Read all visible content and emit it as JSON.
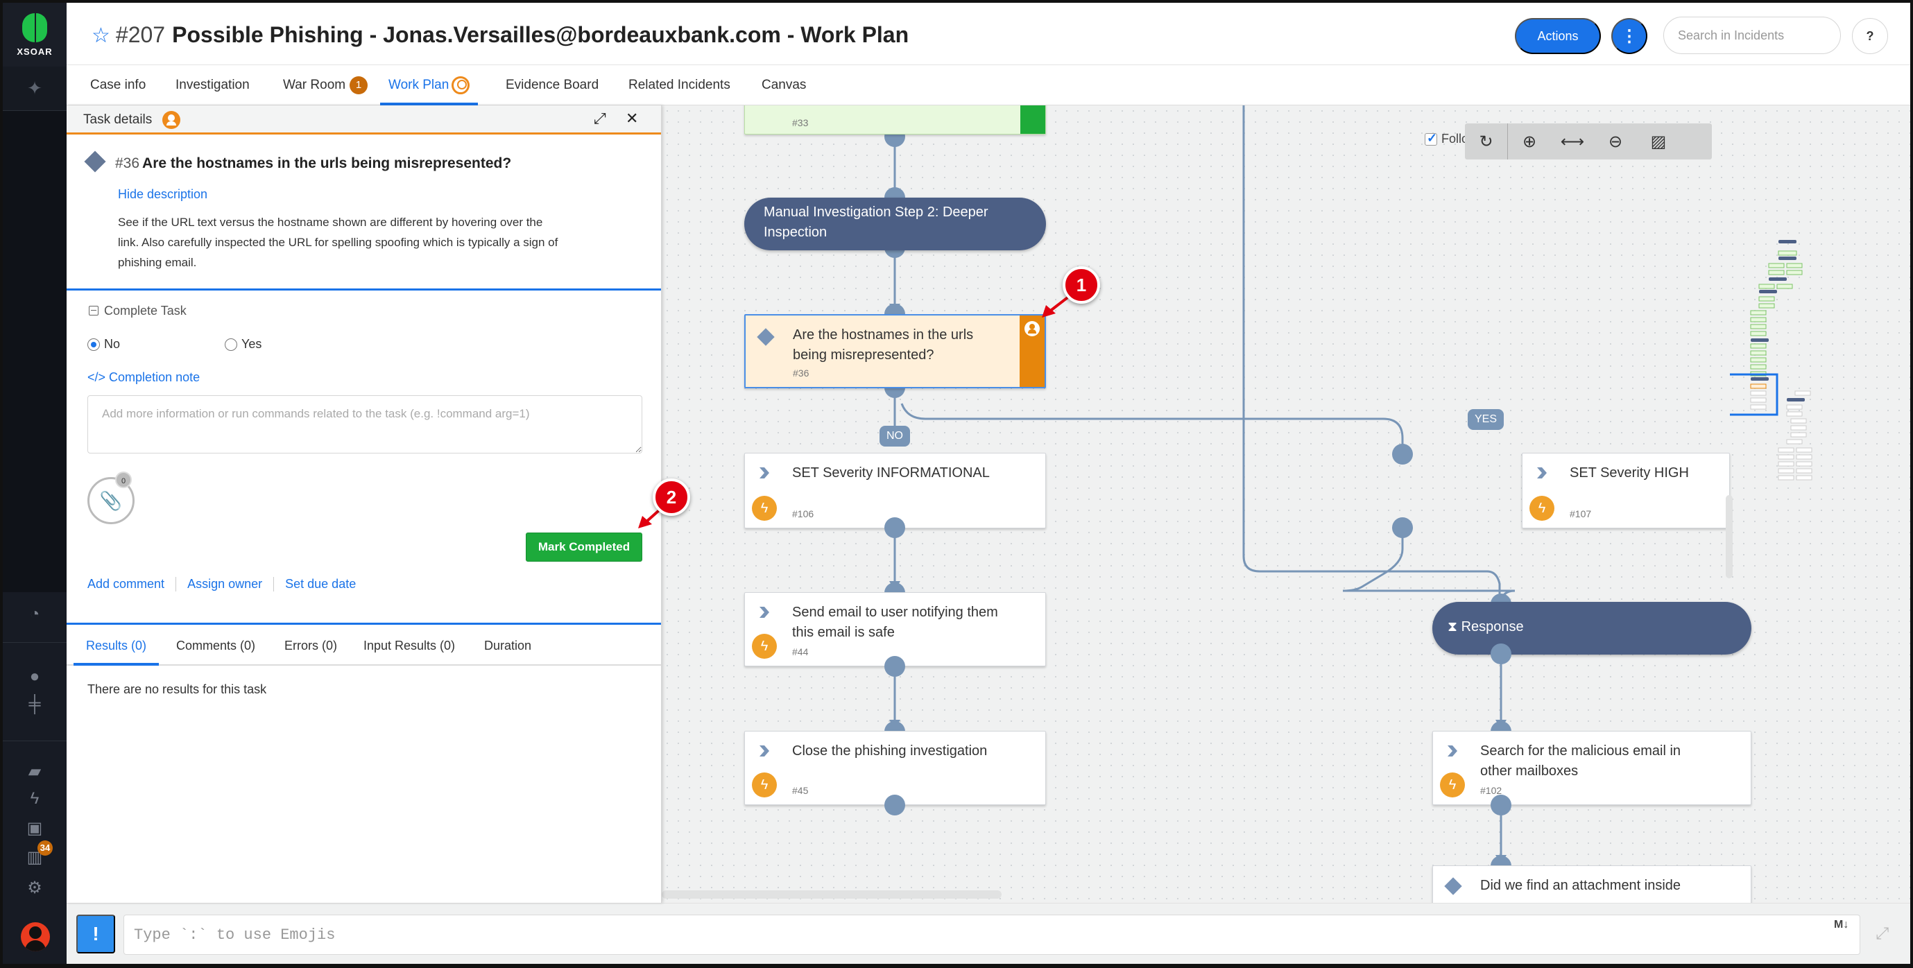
{
  "app": {
    "logo_text": "XSOAR"
  },
  "sidebar": {
    "notification_count": "34",
    "items": [
      {
        "icon": "pin-icon"
      },
      {
        "icon": "dashboard-gauge-icon"
      },
      {
        "icon": "bomb-icon"
      },
      {
        "icon": "signpost-icon"
      },
      {
        "icon": "book-icon"
      },
      {
        "icon": "lightning-icon"
      },
      {
        "icon": "briefcase-icon"
      },
      {
        "icon": "database-icon"
      },
      {
        "icon": "gear-icon"
      },
      {
        "icon": "user-avatar-icon"
      }
    ]
  },
  "header": {
    "incident_number": "#207",
    "incident_name": "Possible Phishing - Jonas.Versailles@bordeauxbank.com - Work Plan",
    "actions_label": "Actions",
    "more_label": "⋮",
    "search_placeholder": "Search in Incidents",
    "help_label": "?"
  },
  "tabs": [
    {
      "label": "Case info"
    },
    {
      "label": "Investigation"
    },
    {
      "label": "War Room",
      "count": "1"
    },
    {
      "label": "Work Plan",
      "active": true
    },
    {
      "label": "Evidence Board"
    },
    {
      "label": "Related Incidents"
    },
    {
      "label": "Canvas"
    }
  ],
  "task_panel": {
    "title": "Task details",
    "task_id": "#36",
    "task_name": "Are the hostnames in the urls being misrepresented?",
    "hide_description": "Hide description",
    "description": "See if the URL text versus the hostname shown are different by hovering over the link. Also carefully inspected the URL for spelling spoofing which is typically a sign of phishing email.",
    "complete_task": "Complete Task",
    "options": [
      {
        "label": "No",
        "selected": true
      },
      {
        "label": "Yes",
        "selected": false
      }
    ],
    "completion_note_label": "Completion note",
    "completion_note_placeholder": "Add more information or run commands related to the task (e.g. !command arg=1)",
    "completion_note_value": "",
    "attachment_count": "0",
    "mark_completed": "Mark Completed",
    "links": [
      "Add comment",
      "Assign owner",
      "Set due date"
    ],
    "result_tabs": [
      {
        "label": "Results (0)",
        "active": true
      },
      {
        "label": "Comments (0)"
      },
      {
        "label": "Errors (0)"
      },
      {
        "label": "Input Results (0)"
      },
      {
        "label": "Duration"
      }
    ],
    "no_results": "There are no results for this task"
  },
  "canvas": {
    "follow_label": "Follow",
    "follow_checked": true,
    "tools": [
      "refresh-icon",
      "zoom-in-icon",
      "fit-width-icon",
      "zoom-out-icon",
      "export-image-icon"
    ],
    "nodes": [
      {
        "id": "#33",
        "name": "",
        "state": "completed"
      },
      {
        "name": "Manual Investigation Step 2: Deeper Inspection",
        "type": "section"
      },
      {
        "id": "#36",
        "name": "Are the hostnames in the urls being misrepresented?",
        "type": "condition",
        "state": "waiting"
      },
      {
        "id": "#106",
        "name": "SET Severity INFORMATIONAL",
        "type": "automation"
      },
      {
        "id": "#44",
        "name": "Send email to user notifying them this email is safe",
        "type": "automation"
      },
      {
        "id": "#45",
        "name": "Close the phishing investigation",
        "type": "automation"
      },
      {
        "id": "#107",
        "name": "SET Severity HIGH",
        "type": "automation"
      },
      {
        "name": "Response",
        "type": "section"
      },
      {
        "id": "#102",
        "name": "Search for the malicious email in other mailboxes",
        "type": "automation"
      },
      {
        "name": "Did we find an attachment inside",
        "type": "condition"
      }
    ],
    "branch_labels": {
      "no": "NO",
      "yes": "YES"
    }
  },
  "chat": {
    "bang_label": "!",
    "placeholder": "Type `:` to use Emojis",
    "value": "",
    "markdown_label": "M↓"
  },
  "annotations": [
    "1",
    "2"
  ],
  "colors": {
    "accent": "#1a73e8",
    "success": "#1daa3b",
    "warning": "#ee8a1b",
    "section": "#4c5f85",
    "callout": "#e1000f"
  }
}
